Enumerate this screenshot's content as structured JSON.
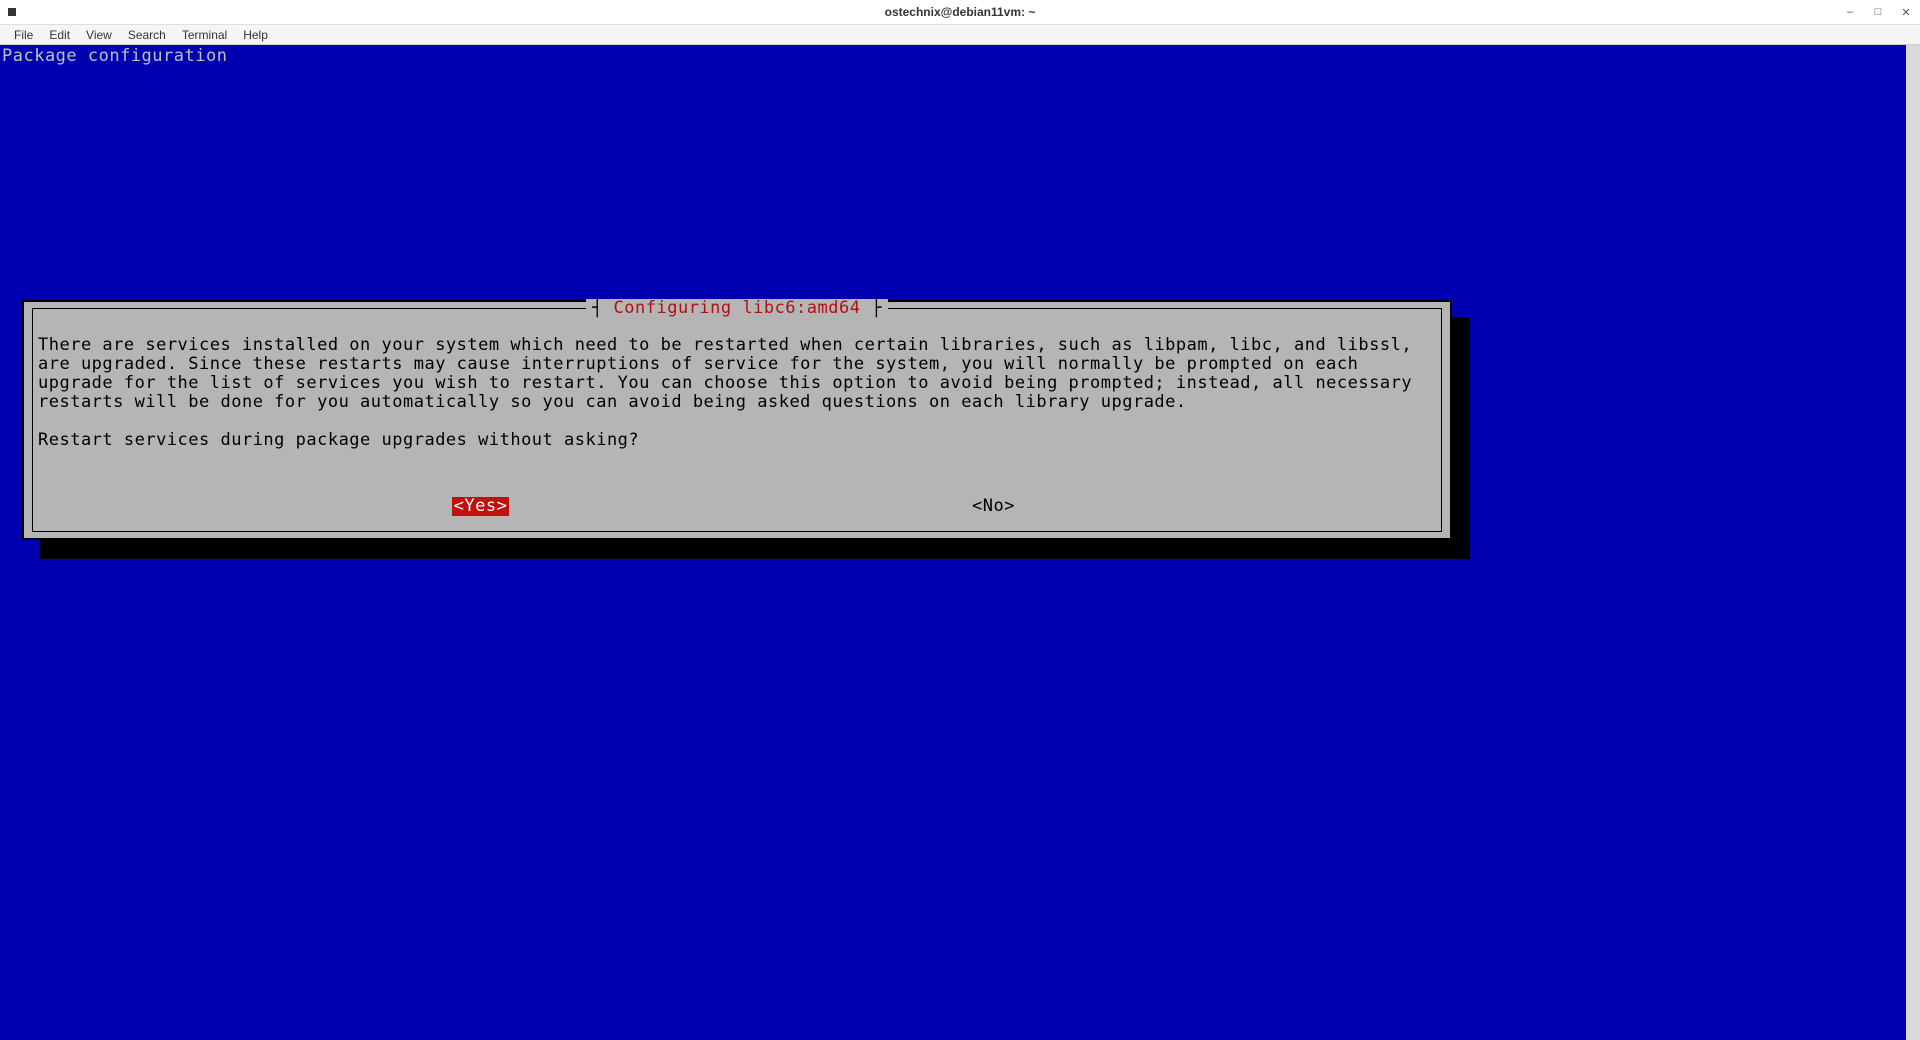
{
  "window": {
    "title": "ostechnix@debian11vm: ~"
  },
  "menubar": {
    "items": [
      "File",
      "Edit",
      "View",
      "Search",
      "Terminal",
      "Help"
    ]
  },
  "terminal": {
    "header": "Package configuration",
    "dialog": {
      "title": "Configuring libc6:amd64",
      "paragraph1": "There are services installed on your system which need to be restarted when certain libraries, such as libpam, libc, and libssl, are upgraded. Since these restarts may cause interruptions of service for the system, you will normally be prompted on each upgrade for the list of services you wish to restart.  You can choose this option to avoid being prompted; instead, all necessary restarts will be done for you automatically so you can avoid being asked questions on each library upgrade.",
      "paragraph2": "Restart services during package upgrades without asking?",
      "buttons": {
        "yes": "<Yes>",
        "no": "<No>"
      }
    }
  }
}
